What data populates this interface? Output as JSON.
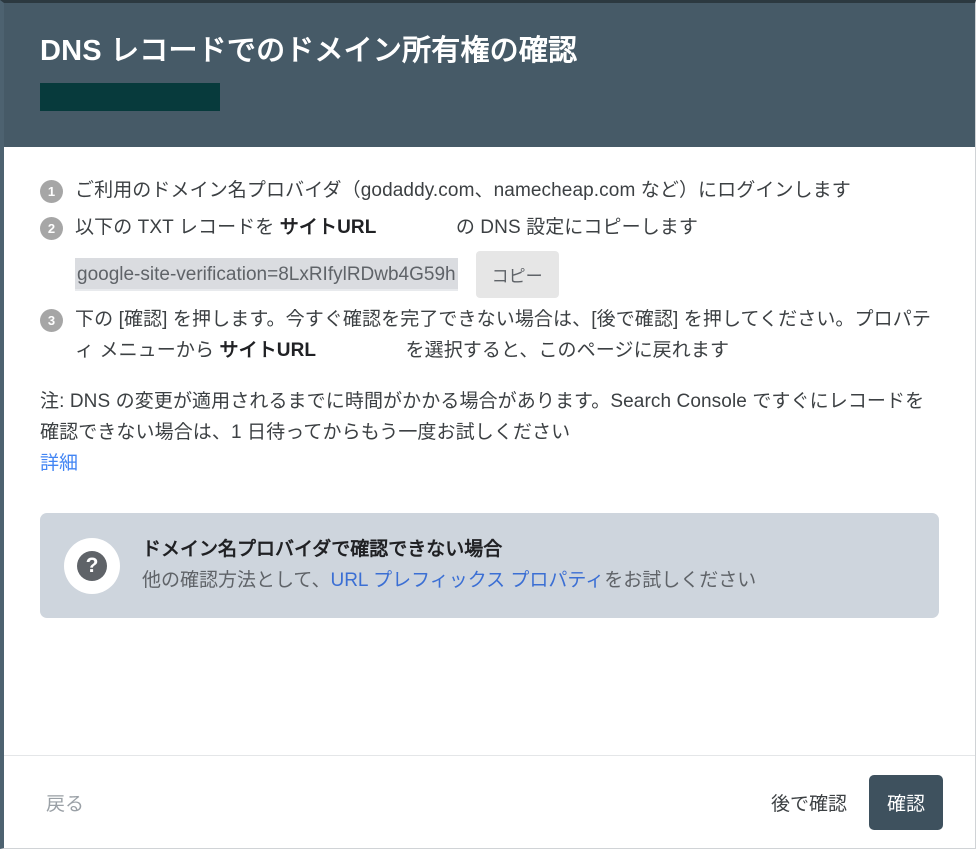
{
  "header": {
    "title": "DNS レコードでのドメイン所有権の確認",
    "redacted_property": ""
  },
  "steps": [
    {
      "number": "1",
      "text_before": "ご利用のドメイン名プロバイダ（godaddy.com、namecheap.com など）にログインします",
      "has_token": false
    },
    {
      "number": "2",
      "text_before": "以下の TXT レコードを ",
      "token": "サイトURL",
      "text_after": " の DNS 設定にコピーします",
      "has_token": true
    },
    {
      "number": "3",
      "text_before": "下の [確認] を押します。今すぐ確認を完了できない場合は、[後で確認] を押してください。プロパティ メニューから ",
      "token": "サイトURL",
      "text_after": " を選択すると、このページに戻れます",
      "has_token": true
    }
  ],
  "record": {
    "value": "google-site-verification=8LxRIfylRDwb4G59h",
    "copy_label": "コピー"
  },
  "note": {
    "text": "注: DNS の変更が適用されるまでに時間がかかる場合があります。Search Console ですぐにレコードを確認できない場合は、1 日待ってからもう一度お試しください",
    "link_label": "詳細"
  },
  "help": {
    "icon": "question-mark-icon",
    "title": "ドメイン名プロバイダで確認できない場合",
    "sub_before": "他の確認方法として、",
    "sub_link": "URL プレフィックス プロパティ",
    "sub_after": "をお試しください"
  },
  "footer": {
    "back_label": "戻る",
    "later_label": "後で確認",
    "verify_label": "確認"
  },
  "colors": {
    "header_bg": "#465a67",
    "redacted": "#073a3c",
    "primary_button": "#3e515e",
    "link": "#4285f4",
    "help_card_bg": "#ced5dd",
    "badge": "#a6a6a6",
    "record_highlight": "#dadce0"
  }
}
